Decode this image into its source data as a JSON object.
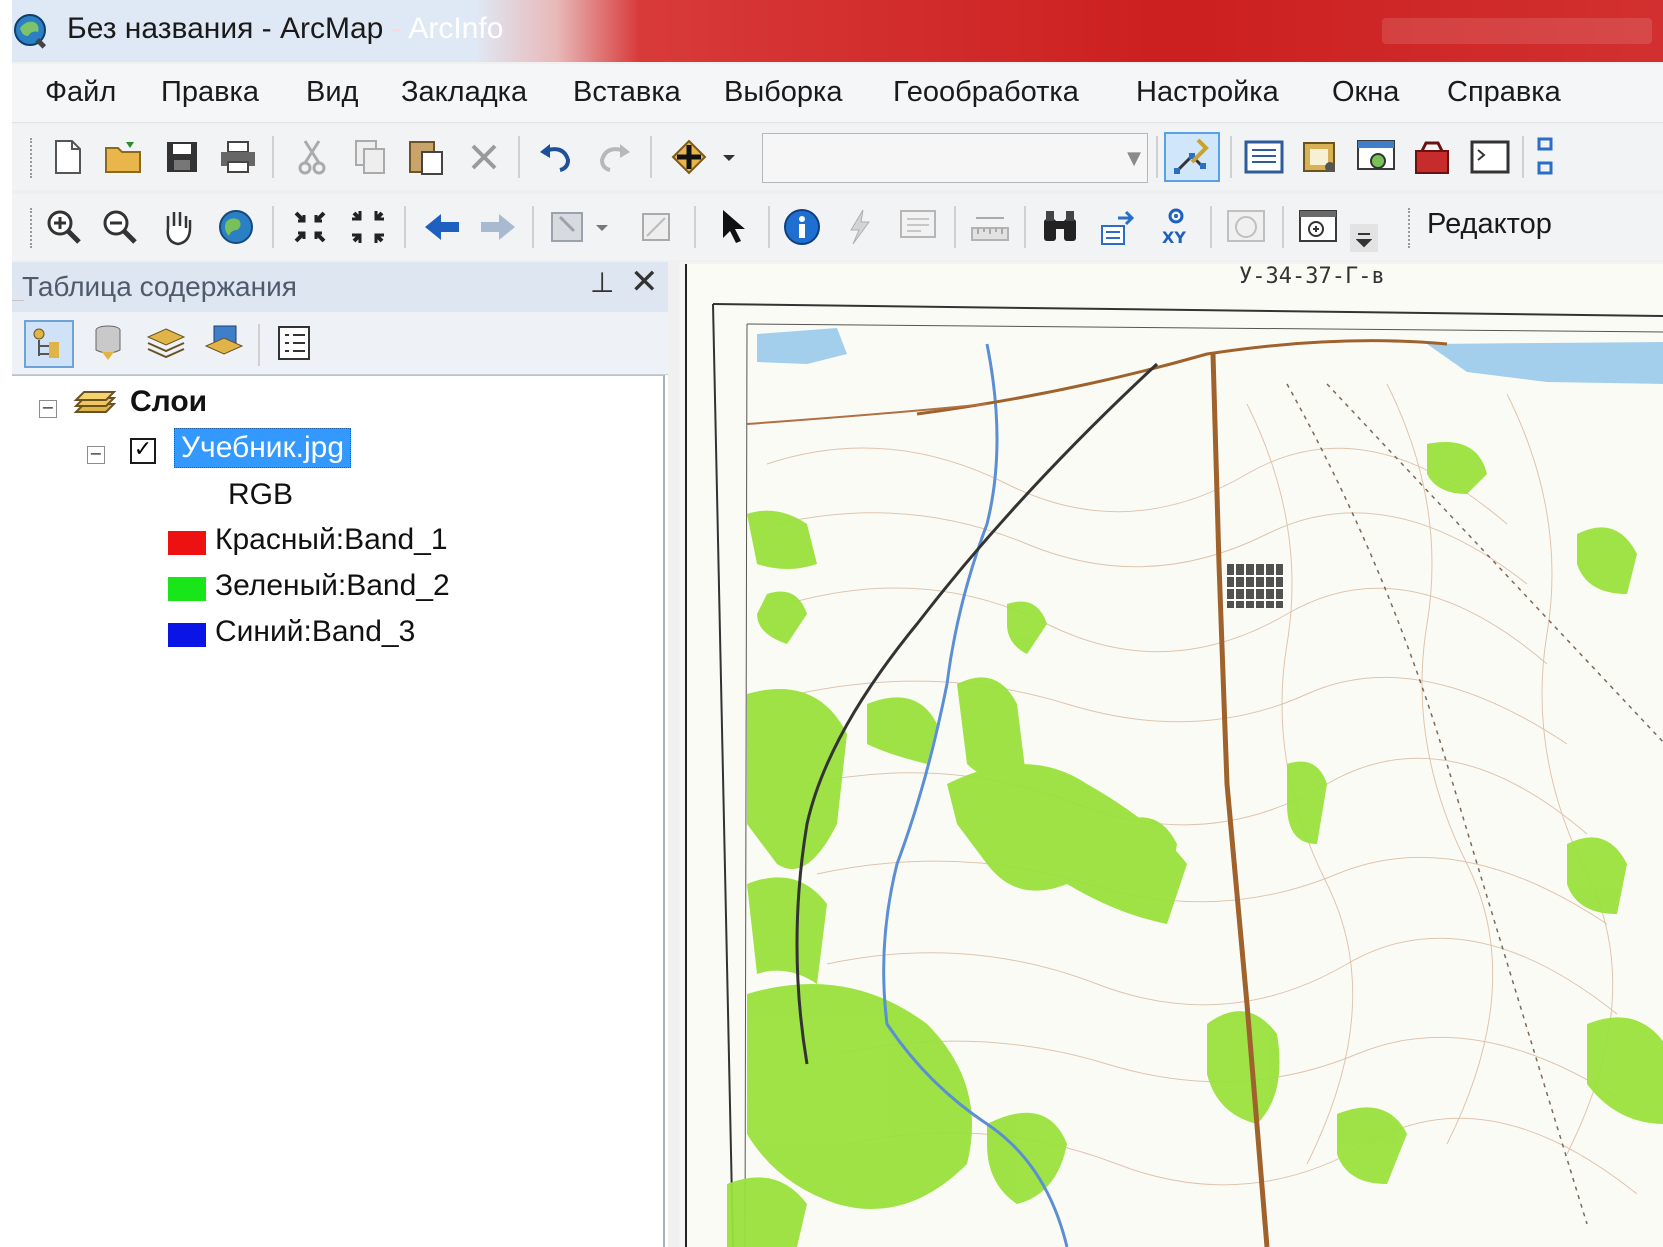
{
  "window": {
    "title_part1": "Без названия - ArcMap",
    "title_part2": " - ",
    "title_part3": "ArcInfo"
  },
  "menu": [
    "Файл",
    "Правка",
    "Вид",
    "Закладка",
    "Вставка",
    "Выборка",
    "Геообработка",
    "Настройка",
    "Окна",
    "Справка"
  ],
  "toolbar": {
    "scale_value": "",
    "editor_label": "Редактор"
  },
  "toc": {
    "title": "Таблица содержания",
    "group_label": "Слои",
    "layer_label": "Учебник.jpg",
    "layer_checked": true,
    "render_label": "RGB",
    "bands": [
      {
        "label": "Красный:Band_1",
        "color": "#ee1111"
      },
      {
        "label": "Зеленый:Band_2",
        "color": "#19e619"
      },
      {
        "label": "Синий:Band_3",
        "color": "#0a14e6"
      }
    ]
  },
  "map": {
    "sheet_label": "У-34-37-Г-в"
  }
}
